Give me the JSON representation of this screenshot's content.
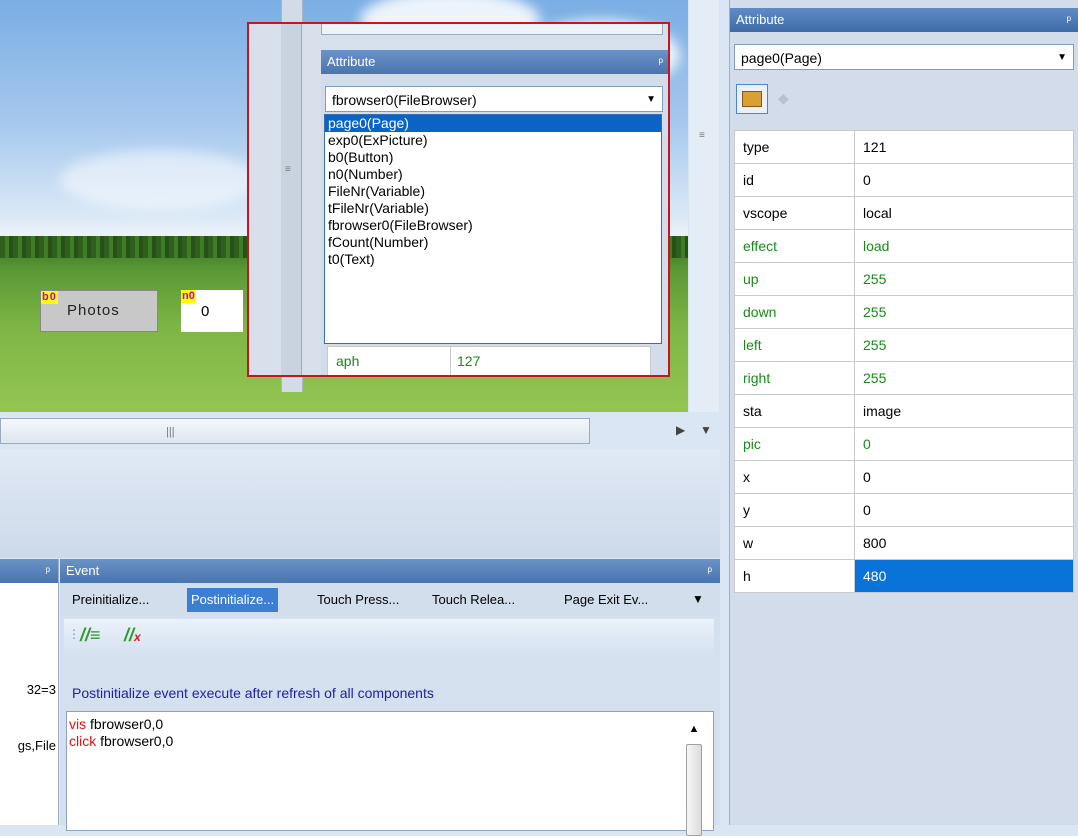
{
  "canvas": {
    "button": {
      "tag": "b0",
      "label": "Photos"
    },
    "number": {
      "tag": "n0",
      "value": "0"
    }
  },
  "popup": {
    "title": "Attribute",
    "pin": "ᵖ",
    "combo_value": "fbrowser0(FileBrowser)",
    "options": [
      "page0(Page)",
      "exp0(ExPicture)",
      "b0(Button)",
      "n0(Number)",
      "FileNr(Variable)",
      "tFileNr(Variable)",
      "fbrowser0(FileBrowser)",
      "fCount(Number)",
      "t0(Text)"
    ],
    "row": {
      "key": "aph",
      "value": "127"
    }
  },
  "right_panel": {
    "title": "Attribute",
    "combo_value": "page0(Page)",
    "rows": [
      {
        "key": "type",
        "value": "121",
        "green": false
      },
      {
        "key": "id",
        "value": "0",
        "green": false
      },
      {
        "key": "vscope",
        "value": "local",
        "green": false
      },
      {
        "key": "effect",
        "value": "load",
        "green": true
      },
      {
        "key": "up",
        "value": "255",
        "green": true
      },
      {
        "key": "down",
        "value": "255",
        "green": true
      },
      {
        "key": "left",
        "value": "255",
        "green": true
      },
      {
        "key": "right",
        "value": "255",
        "green": true
      },
      {
        "key": "sta",
        "value": "image",
        "green": false
      },
      {
        "key": "pic",
        "value": "0",
        "green": true
      },
      {
        "key": "x",
        "value": "0",
        "green": false
      },
      {
        "key": "y",
        "value": "0",
        "green": false
      },
      {
        "key": "w",
        "value": "800",
        "green": false
      },
      {
        "key": "h",
        "value": "480",
        "green": false,
        "selected": true
      }
    ]
  },
  "left_bottom": {
    "line1": "32=3",
    "line2": "gs,File"
  },
  "event": {
    "title": "Event",
    "tabs": [
      "Preinitialize...",
      "Postinitialize...",
      "Touch Press...",
      "Touch Relea...",
      "Page Exit Ev..."
    ],
    "active_tab": 1,
    "description": "Postinitialize event execute after refresh of all components",
    "code": [
      {
        "kw": "vis",
        "rest": " fbrowser0,0"
      },
      {
        "kw": "click",
        "rest": " fbrowser0,0"
      }
    ]
  }
}
